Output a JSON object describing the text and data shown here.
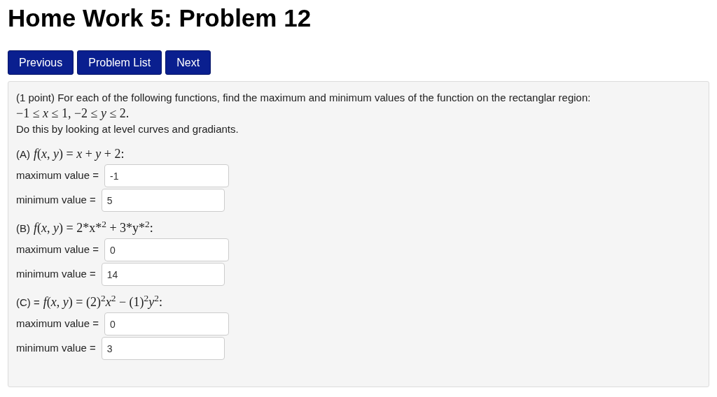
{
  "title": "Home Work 5: Problem 12",
  "nav_buttons": [
    "Previous",
    "Problem List",
    "Next"
  ],
  "intro": "(1 point) For each of the following functions, find the maximum and minimum values of the function on the rectanglar region:",
  "region": "−1 ≤ *x* ≤ 1, −2 ≤ *y* ≤ 2.",
  "instruction": "Do this by looking at level curves and gradiants.",
  "parts": [
    {
      "label": "(A)",
      "formula": "*f*(*x*, *y*) = *x* + *y* + 2:",
      "answers": [
        {
          "label": "maximum value =",
          "value": "-1"
        },
        {
          "label": "minimum value =",
          "value": "5"
        }
      ]
    },
    {
      "label": "(B)",
      "formula": "*f*(*x*, *y*) = 2*x*$^{2}$ + 3*y*$^{2}$:",
      "answers": [
        {
          "label": "maximum value =",
          "value": "0"
        },
        {
          "label": "minimum value =",
          "value": "14"
        }
      ]
    },
    {
      "label": "(C) =",
      "formula": "*f*(*x*, *y*) = (2)$^{2}$*x*$^{2}$ − (1)$^{2}$*y*$^{2}$:",
      "answers": [
        {
          "label": "maximum value =",
          "value": "0"
        },
        {
          "label": "minimum value =",
          "value": "3"
        }
      ]
    }
  ]
}
